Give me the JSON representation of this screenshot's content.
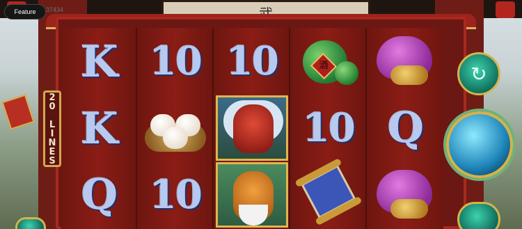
{
  "feature_button": {
    "label": "Feature",
    "ghost_text": "37434"
  },
  "sign": {
    "glyph": "武"
  },
  "lines_badge": {
    "text": "20 LINES"
  },
  "reels": [
    {
      "cells": [
        {
          "type": "text",
          "value": "K"
        },
        {
          "type": "text",
          "value": "K"
        },
        {
          "type": "text",
          "value": "Q"
        }
      ]
    },
    {
      "cells": [
        {
          "type": "text",
          "value": "10"
        },
        {
          "type": "icon",
          "value": "bao-buns-icon"
        },
        {
          "type": "text",
          "value": "10"
        }
      ]
    },
    {
      "cells": [
        {
          "type": "text",
          "value": "10"
        },
        {
          "type": "icon",
          "value": "dragon-portrait-icon"
        },
        {
          "type": "icon",
          "value": "tiger-portrait-icon"
        }
      ]
    },
    {
      "cells": [
        {
          "type": "icon",
          "value": "wine-jar-icon"
        },
        {
          "type": "text",
          "value": "10"
        },
        {
          "type": "icon",
          "value": "scroll-icon"
        }
      ]
    },
    {
      "cells": [
        {
          "type": "icon",
          "value": "coin-bag-icon"
        },
        {
          "type": "text",
          "value": "Q"
        },
        {
          "type": "icon",
          "value": "coin-bag-icon"
        }
      ]
    }
  ],
  "jar_glyph": "酒",
  "controls": {
    "autoplay_icon": "↻",
    "spin_icon": "spin-icon"
  },
  "colors": {
    "frame": "#a9281d",
    "reel_bg": "#8a1d15",
    "gold": "#d4a84a",
    "accent": "#1d84b8"
  }
}
